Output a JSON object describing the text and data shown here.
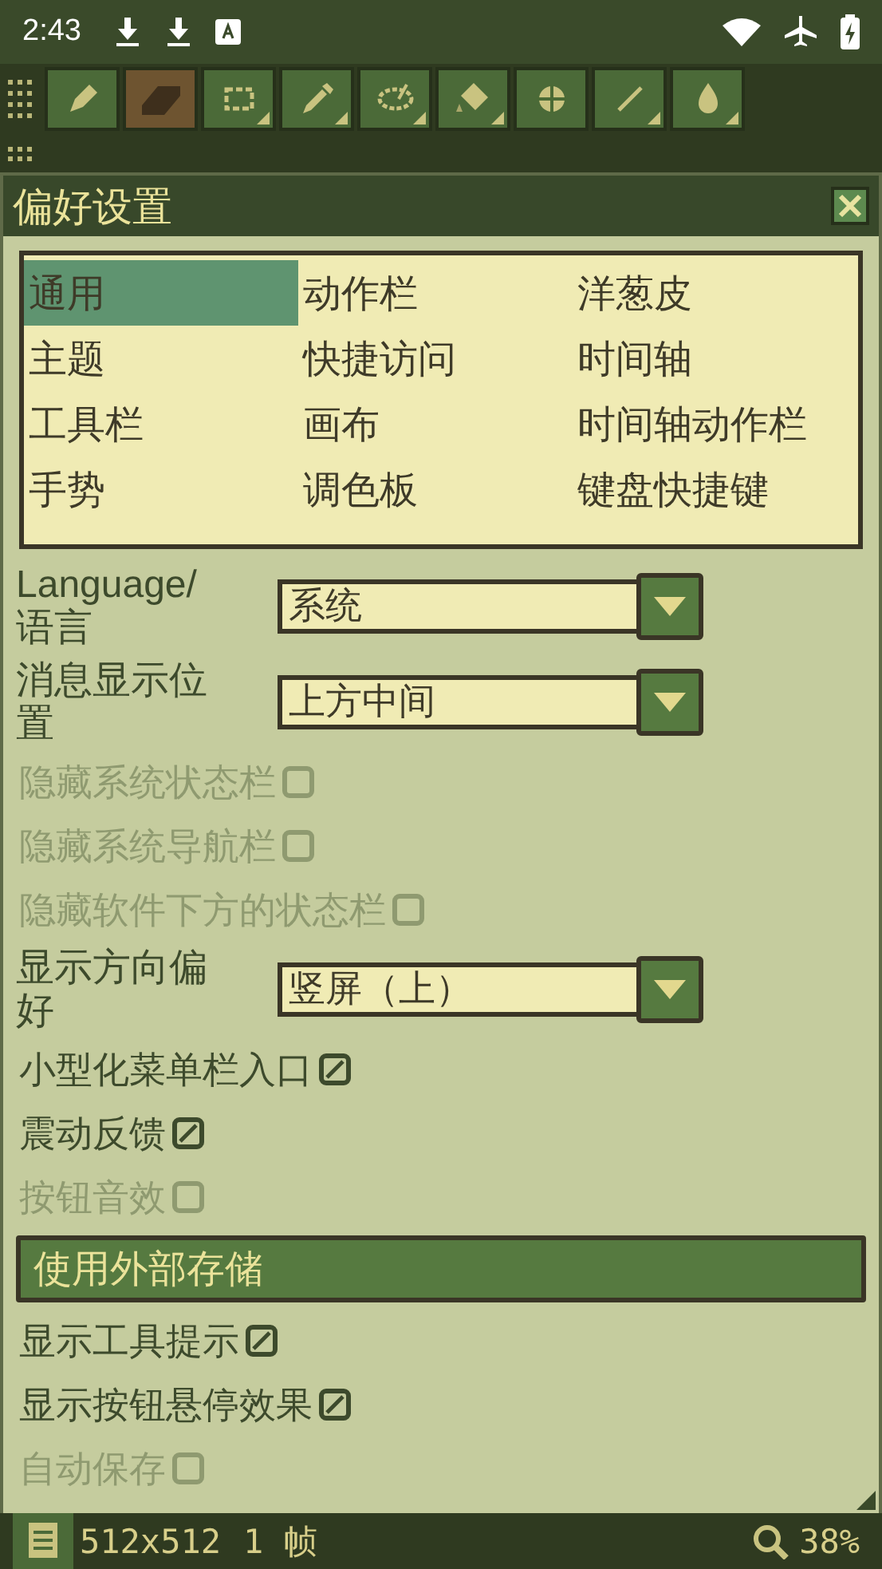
{
  "status_bar": {
    "time": "2:43"
  },
  "tools": [
    {
      "selected": false,
      "expandable": false
    },
    {
      "selected": true,
      "expandable": false
    },
    {
      "selected": false,
      "expandable": true
    },
    {
      "selected": false,
      "expandable": true
    },
    {
      "selected": false,
      "expandable": true
    },
    {
      "selected": false,
      "expandable": true
    },
    {
      "selected": false,
      "expandable": false
    },
    {
      "selected": false,
      "expandable": true
    },
    {
      "selected": false,
      "expandable": true
    }
  ],
  "dialog": {
    "title": "偏好设置",
    "categories": [
      {
        "label": "通用",
        "selected": true
      },
      {
        "label": "动作栏",
        "selected": false
      },
      {
        "label": "洋葱皮",
        "selected": false
      },
      {
        "label": "主题",
        "selected": false
      },
      {
        "label": "快捷访问",
        "selected": false
      },
      {
        "label": "时间轴",
        "selected": false
      },
      {
        "label": "工具栏",
        "selected": false
      },
      {
        "label": "画布",
        "selected": false
      },
      {
        "label": "时间轴动作栏",
        "selected": false
      },
      {
        "label": "手势",
        "selected": false
      },
      {
        "label": "调色板",
        "selected": false
      },
      {
        "label": "键盘快捷键",
        "selected": false
      }
    ],
    "settings": [
      {
        "kind": "dropdown",
        "label": "Language/语言",
        "value": "系统"
      },
      {
        "kind": "dropdown",
        "label": "消息显示位置",
        "value": "上方中间"
      },
      {
        "kind": "checkbox",
        "label": "隐藏系统状态栏",
        "checked": false,
        "disabled": true
      },
      {
        "kind": "checkbox",
        "label": "隐藏系统导航栏",
        "checked": false,
        "disabled": true
      },
      {
        "kind": "checkbox",
        "label": "隐藏软件下方的状态栏",
        "checked": false,
        "disabled": true
      },
      {
        "kind": "dropdown",
        "label": "显示方向偏好",
        "value": "竖屏（上）"
      },
      {
        "kind": "checkbox",
        "label": "小型化菜单栏入口",
        "checked": true,
        "disabled": false
      },
      {
        "kind": "checkbox",
        "label": "震动反馈",
        "checked": true,
        "disabled": false
      },
      {
        "kind": "checkbox",
        "label": "按钮音效",
        "checked": false,
        "disabled": true
      },
      {
        "kind": "button",
        "label": "使用外部存储"
      },
      {
        "kind": "checkbox",
        "label": "显示工具提示",
        "checked": true,
        "disabled": false
      },
      {
        "kind": "checkbox",
        "label": "显示按钮悬停效果",
        "checked": true,
        "disabled": false
      },
      {
        "kind": "checkbox",
        "label": "自动保存",
        "checked": false,
        "disabled": true
      }
    ]
  },
  "bottom_bar": {
    "canvas_size": "512x512",
    "frames": "1 帧",
    "zoom": "38%"
  }
}
